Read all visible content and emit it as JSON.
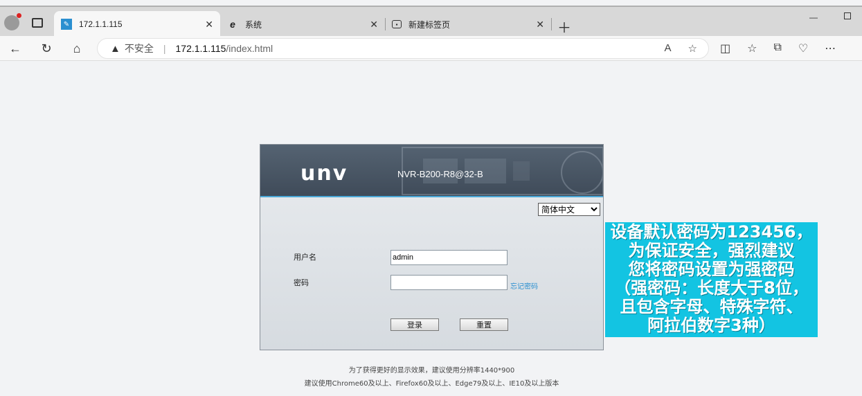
{
  "browser": {
    "tabs": [
      {
        "label": "172.1.1.115",
        "active": true
      },
      {
        "label": "系统",
        "active": false
      },
      {
        "label": "新建标签页",
        "active": false
      }
    ],
    "address": {
      "warning": "不安全",
      "host": "172.1.1.115",
      "path": "/index.html"
    }
  },
  "login": {
    "logo": "unv",
    "model": "NVR-B200-R8@32-B",
    "language": "简体中文",
    "username_label": "用户名",
    "username_value": "admin",
    "password_label": "密码",
    "forgot_label": "忘记密码",
    "login_button": "登录",
    "reset_button": "重置"
  },
  "footer": {
    "line1": "为了获得更好的显示效果，建议使用分辨率1440*900",
    "line2": "建议使用Chrome60及以上、Firefox60及以上、Edge79及以上、IE10及以上版本"
  },
  "note": {
    "lines": [
      "设备默认密码为123456，",
      "为保证安全，强烈建议",
      "您将密码设置为强密码",
      "（强密码：长度大于8位，",
      "且包含字母、特殊字符、",
      "阿拉伯数字3种）"
    ]
  },
  "colors": {
    "note_bg": "#13c4e2",
    "header_bg": "#4a5666",
    "accent": "#4aa8d8"
  }
}
